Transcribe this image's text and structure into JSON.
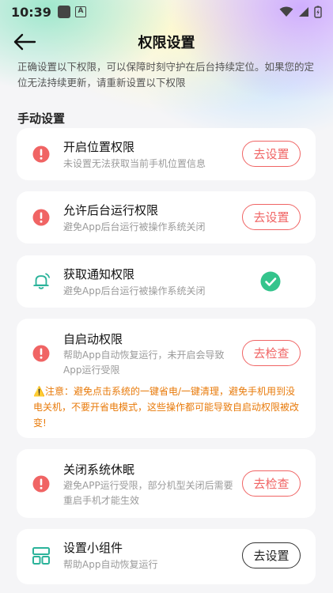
{
  "status_bar": {
    "time": "10:39",
    "a_label": "A"
  },
  "header": {
    "title": "权限设置"
  },
  "intro": "正确设置以下权限，可以保障时刻守护在后台持续定位。如果您的定位无法持续更新，请重新设置以下权限",
  "section_title": "手动设置",
  "cards": [
    {
      "title": "开启位置权限",
      "desc": "未设置无法获取当前手机位置信息",
      "action": "去设置",
      "icon": "alert-icon"
    },
    {
      "title": "允许后台运行权限",
      "desc": "避免App后台运行被操作系统关闭",
      "action": "去设置",
      "icon": "alert-icon"
    },
    {
      "title": "获取通知权限",
      "desc": "避免App后台运行被操作系统关闭",
      "action": "",
      "icon": "bell-icon",
      "status": "granted"
    },
    {
      "title": "自启动权限",
      "desc": "帮助App自动恢复运行，未开启会导致App运行受限",
      "action": "去检查",
      "icon": "alert-icon",
      "warning": "⚠️注意：避免点击系统的一键省电/一键清理，避免手机用到没电关机，不要开省电模式，这些操作都可能导致自启动权限被改变!"
    },
    {
      "title": "关闭系统休眠",
      "desc": "避免APP运行受限，部分机型关闭后需要重启手机才能生效",
      "action": "去检查",
      "icon": "alert-icon"
    },
    {
      "title": "设置小组件",
      "desc": "帮助App自动恢复运行",
      "action": "去设置",
      "icon": "widget-icon"
    }
  ],
  "colors": {
    "accent_red": "#f06464",
    "warning_orange": "#e87a0a",
    "check_green": "#34c48c",
    "widget_teal": "#2bb39a"
  }
}
